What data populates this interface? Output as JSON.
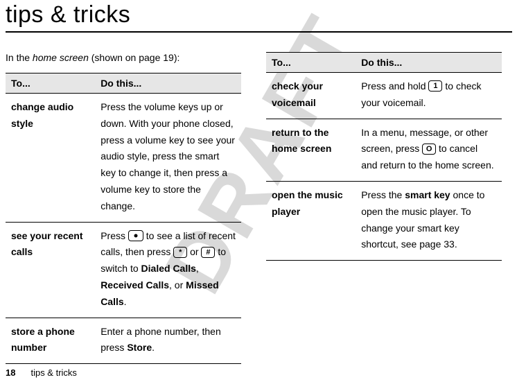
{
  "watermark": "DRAFT",
  "title": "tips & tricks",
  "intro_prefix": "In the ",
  "intro_em": "home screen",
  "intro_suffix_a": " (shown on page ",
  "intro_page_ref": "19",
  "intro_suffix_b": "):",
  "headers": {
    "to": "To...",
    "do": "Do this..."
  },
  "left_rows": [
    {
      "key": "change audio style",
      "do_parts": [
        {
          "t": "Press the volume keys up or down. With your phone closed, press a volume key to see your audio style, press the smart key to change it, then press a volume key to store the change."
        }
      ]
    },
    {
      "key": "see your recent calls",
      "do_parts": [
        {
          "t": "Press "
        },
        {
          "key": "nav"
        },
        {
          "t": " to see a list of recent calls, then press "
        },
        {
          "key": "star"
        },
        {
          "t": " or "
        },
        {
          "key": "hash"
        },
        {
          "t": " to switch to "
        },
        {
          "cond": "Dialed Calls"
        },
        {
          "t": ", "
        },
        {
          "cond": "Received Calls"
        },
        {
          "t": ", or "
        },
        {
          "cond": "Missed Calls"
        },
        {
          "t": "."
        }
      ]
    },
    {
      "key": "store a phone number",
      "do_parts": [
        {
          "t": "Enter a phone number, then press "
        },
        {
          "cond": "Store"
        },
        {
          "t": "."
        }
      ]
    }
  ],
  "right_rows": [
    {
      "key": "check your voicemail",
      "do_parts": [
        {
          "t": "Press and hold "
        },
        {
          "key": "one"
        },
        {
          "t": " to check your voicemail."
        }
      ]
    },
    {
      "key": "return to the home screen",
      "do_parts": [
        {
          "t": "In a menu, message, or other screen, press "
        },
        {
          "key": "end"
        },
        {
          "t": " to cancel and return to the home screen."
        }
      ]
    },
    {
      "key": "open the music player",
      "do_parts": [
        {
          "t": "Press the "
        },
        {
          "bold": "smart key"
        },
        {
          "t": " once to open the music player. To change your smart key shortcut, see page "
        },
        {
          "t": "33"
        },
        {
          "t": "."
        }
      ]
    }
  ],
  "keycaps": {
    "nav": "",
    "star": "*",
    "hash": "#",
    "one": "1",
    "end": "O"
  },
  "footer": {
    "page": "18",
    "section": "tips & tricks"
  }
}
